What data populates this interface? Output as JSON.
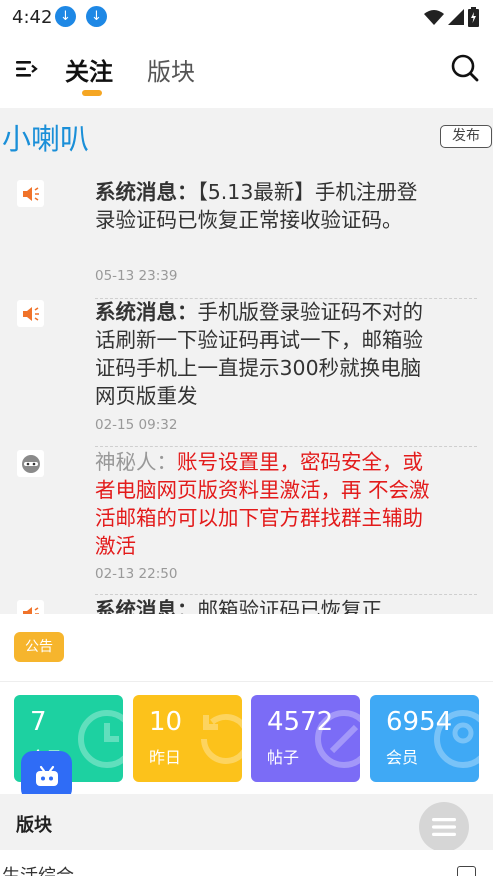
{
  "status_bar": {
    "time": "4:42",
    "icons_left": [
      "download-icon",
      "download-icon"
    ],
    "icons_right": [
      "wifi-icon",
      "signal-icon",
      "battery-icon"
    ]
  },
  "header": {
    "tabs": [
      {
        "label": "关注",
        "active": true
      },
      {
        "label": "版块",
        "active": false
      }
    ],
    "accent_color": "#f5a623"
  },
  "notice": {
    "title": "小喇叭",
    "publish_label": "发布",
    "messages": [
      {
        "sender": "系统消息：",
        "text": "【5.13最新】手机注册登录验证码已恢复正常接收验证码。",
        "time": "05-13 23:39",
        "icon": "speaker-icon"
      },
      {
        "sender": "系统消息：",
        "text": "手机版登录验证码不对的话刷新一下验证码再试一下，邮箱验证码手机上一直提示300秒就换电脑网页版重发",
        "time": "02-15 09:32",
        "icon": "speaker-icon"
      },
      {
        "sender": "神秘人：",
        "text": "账号设置里，密码安全，或者电脑网页版资料里激活，再 不会激活邮箱的可以加下官方群找群主辅助激活",
        "time": "02-13 22:50",
        "icon": "mystery-avatar-icon"
      },
      {
        "sender": "系统消息：",
        "text": "邮箱验证码已恢复正",
        "time": "",
        "icon": "speaker-icon"
      }
    ]
  },
  "announcement": {
    "badge": "公告"
  },
  "stats": [
    {
      "value": "7",
      "label": "今日",
      "color": "#1dd1a1"
    },
    {
      "value": "10",
      "label": "昨日",
      "color": "#fcc21b"
    },
    {
      "value": "4572",
      "label": "帖子",
      "color": "#7b6cf6"
    },
    {
      "value": "6954",
      "label": "会员",
      "color": "#3fa9f5"
    }
  ],
  "section": {
    "title": "版块"
  },
  "next_item": {
    "label": "生活综合"
  }
}
